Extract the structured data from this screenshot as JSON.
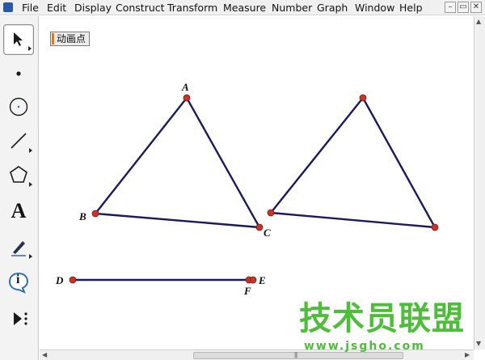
{
  "menubar": {
    "items": [
      "File",
      "Edit",
      "Display",
      "Construct",
      "Transform",
      "Measure",
      "Number",
      "Graph",
      "Window",
      "Help"
    ],
    "minimize": "–",
    "restore": "▭",
    "close": "✕"
  },
  "toolbox": {
    "tools": [
      {
        "name": "arrow-tool-icon",
        "active": true
      },
      {
        "name": "point-tool-icon",
        "active": false
      },
      {
        "name": "compass-tool-icon",
        "active": false
      },
      {
        "name": "straightedge-tool-icon",
        "active": false
      },
      {
        "name": "polygon-tool-icon",
        "active": false
      },
      {
        "name": "text-tool-icon",
        "active": false
      },
      {
        "name": "marker-tool-icon",
        "active": false
      },
      {
        "name": "information-tool-icon",
        "active": false
      },
      {
        "name": "custom-tool-icon",
        "active": false
      }
    ],
    "text_tool_glyph": "A",
    "info_tool_glyph": "i"
  },
  "canvas": {
    "animate_button_label": "动画点",
    "points": {
      "A": "A",
      "B": "B",
      "C": "C",
      "D": "D",
      "E": "E",
      "F": "F"
    },
    "line_color": "#1a1a5e",
    "point_color": "#c8342a"
  },
  "watermark": {
    "text": "技术员联盟",
    "url": "www.jsgho.com",
    "color": "#4ebd3a"
  }
}
